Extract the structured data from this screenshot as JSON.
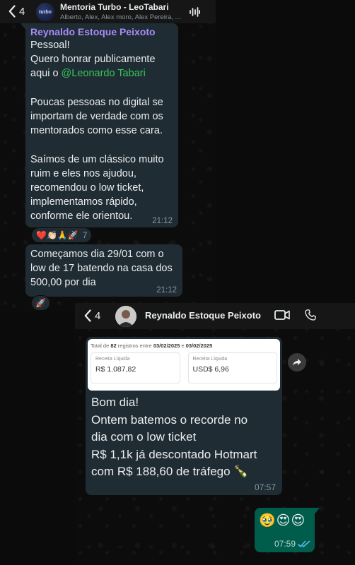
{
  "group_chat": {
    "back_count": "4",
    "avatar_text": "turbo",
    "title": "Mentoria Turbo - LeoTabari",
    "members": "Alberto, Alex, Alex moro, Alex Pereira, Alex...",
    "message1": {
      "sender": "Reynaldo Estoque Peixoto",
      "intro": "Pessoal!\nQuero honrar publicamente\naqui o ",
      "mention": "@Leonardo Tabari",
      "body": "\n\nPoucas pessoas no digital se\nimportam de verdade com os\nmentorados como esse cara.\n\nSaímos de um clássico muito\nruim e eles nos ajudou,\nrecomendou o low ticket,\nimplementamos rápido,\nconforme ele orientou.",
      "time": "21:12",
      "reactions": "❤️👏🏻🙏🚀",
      "reaction_count": "7"
    },
    "message2": {
      "text": "Começamos dia 29/01 com o\nlow de 17 batendo na casa dos\n500,00 por dia",
      "time": "21:12",
      "reactions": "🚀"
    }
  },
  "direct_chat": {
    "back_count": "4",
    "contact_name": "Reynaldo Estoque Peixoto",
    "image_card": {
      "summary_prefix": "Total de ",
      "summary_count": "82",
      "summary_mid": " registros entre ",
      "date_from": "03/02/2025",
      "summary_and": " e ",
      "date_to": "03/02/2025",
      "metrics": [
        {
          "label": "Receita Líquida",
          "value": "R$ 1.087,82"
        },
        {
          "label": "Receita Líquida",
          "value": "USD$ 6,96"
        }
      ]
    },
    "message_text": "Bom dia!\nOntem batemos o recorde no\ndia com o low ticket\nR$ 1,1k já descontado Hotmart\ncom R$ 188,60 de tráfego 🍾",
    "message_time": "07:57",
    "reply": {
      "emojis": "🥹😍😍",
      "time": "07:59"
    }
  },
  "colors": {
    "incoming_bubble": "#202c33",
    "outgoing_bubble": "#005c4b",
    "sender_name": "#a78bfa",
    "mention": "#34c759",
    "read_ticks": "#53bdeb"
  },
  "icons": [
    "back-chevron-icon",
    "waveform-icon",
    "video-call-icon",
    "phone-icon",
    "share-icon",
    "read-ticks-icon"
  ]
}
